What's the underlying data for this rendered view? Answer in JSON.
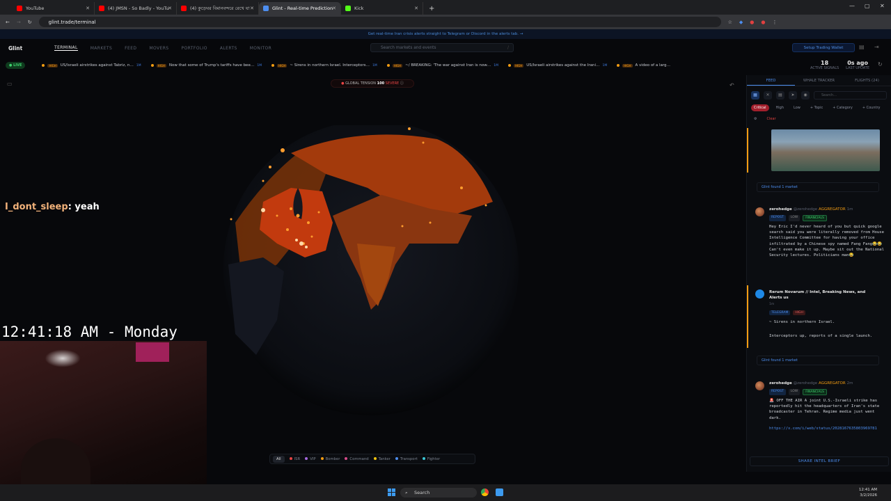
{
  "browser": {
    "tabs": [
      {
        "title": "YouTube",
        "color": "#ff0000"
      },
      {
        "title": "(4) JMSN - So Badly - YouTu",
        "color": "#ff0000"
      },
      {
        "title": "(4) কুড়েঘর বিমানবন্দরে রেখে যা",
        "color": "#ff0000"
      },
      {
        "title": "Glint - Real-time Prediction",
        "color": "#4d8ef0"
      },
      {
        "title": "Kick",
        "color": "#53fc18"
      }
    ],
    "url": "glint.trade/terminal"
  },
  "banner": "Get real-time Iran crisis alerts straight to Telegram or Discord in the alerts tab. →",
  "nav": {
    "logo": "Glint",
    "items": [
      "TERMINAL",
      "MARKETS",
      "FEED",
      "MOVERS",
      "PORTFOLIO",
      "ALERTS",
      "MONITOR"
    ],
    "search_placeholder": "Search markets and events",
    "search_shortcut": "/",
    "wallet_button": "Setup Trading Wallet"
  },
  "ticker": {
    "live_label": "LIVE",
    "items": [
      {
        "badge": "HIGH",
        "text": "US/Israeli airstrikes against Tabriz, n…",
        "age": "1M"
      },
      {
        "badge": "HIGH",
        "text": "Now that some of Trump's tariffs have bee…",
        "age": "1M"
      },
      {
        "badge": "HIGH",
        "text": "~ Sirens in northern Israel. Interceptors…",
        "age": "1M"
      },
      {
        "badge": "HIGH",
        "text": "~/ BREAKING: 'The war against Iran is now…",
        "age": "1M"
      },
      {
        "badge": "HIGH",
        "text": "US/Israeli airstrikes against the Irani…",
        "age": "1M"
      },
      {
        "badge": "HIGH",
        "text": "A video of a larg…",
        "age": ""
      }
    ],
    "active_signals_value": "18",
    "active_signals_label": "ACTIVE SIGNALS",
    "last_update_value": "0s ago",
    "last_update_label": "LAST UPDATE"
  },
  "tension": {
    "label": "GLOBAL TENSION",
    "value": "100",
    "level": "SEVERE"
  },
  "legend": {
    "all": "All",
    "items": [
      {
        "label": "ISR",
        "color": "#e84545"
      },
      {
        "label": "VIP",
        "color": "#a569e0"
      },
      {
        "label": "Bomber",
        "color": "#f39c12"
      },
      {
        "label": "Command",
        "color": "#d64b8a"
      },
      {
        "label": "Tanker",
        "color": "#f1c40f"
      },
      {
        "label": "Transport",
        "color": "#4d8ef0"
      },
      {
        "label": "Fighter",
        "color": "#3ac7d6"
      }
    ]
  },
  "overlay": {
    "chat_user": "I_dont_sleep",
    "chat_message": ": yeah",
    "clock": "12:41:18 AM - Monday"
  },
  "panel": {
    "tabs": [
      "FEED",
      "WHALE TRACKER",
      "FLIGHTS (24)"
    ],
    "search_placeholder": "Search...",
    "filters": [
      "Critical",
      "High",
      "Low",
      "+ Topic",
      "+ Category",
      "+ Country",
      "Clear"
    ],
    "found_label": "Glint found 1 market",
    "posts": [
      {
        "name": "zerohedge",
        "handle": "@zerohedge",
        "type": "AGGREGATOR",
        "age": "1m",
        "tags": [
          "REPOST",
          "LOW",
          "FINANCIALS"
        ],
        "body": "Hey Eric I'd never heard of you but quick google search said you were literally removed from House Intelligence Committee for having your office infiltrated by a Chinese spy named Fang Fang😂😂 Can't even make it up. Maybe sit out the National Security lectures. Politicians man😂"
      },
      {
        "name": "Rerum Novarum // Intel, Breaking News, and Alerts us",
        "age": "1m",
        "tags": [
          "TELEGRAM",
          "HIGH"
        ],
        "body1": "~ Sirens in northern Israel.",
        "body2": "Interceptors up, reports of a single launch."
      },
      {
        "name": "zerohedge",
        "handle": "@zerohedge",
        "type": "AGGREGATOR",
        "age": "2m",
        "tags": [
          "REPOST",
          "LOW",
          "FINANCIALS"
        ],
        "body": "🚨 OFF THE AIR A joint U.S.-Israeli strike has reportedly hit the headquarters of Iran's state broadcaster in Tehran. Regime media just went dark.",
        "link": "https://x.com/i/web/status/2028167635803969781"
      }
    ],
    "share_button": "SHARE INTEL BRIEF"
  },
  "taskbar": {
    "search": "Search",
    "time": "12:41 AM",
    "date": "3/2/2026"
  }
}
